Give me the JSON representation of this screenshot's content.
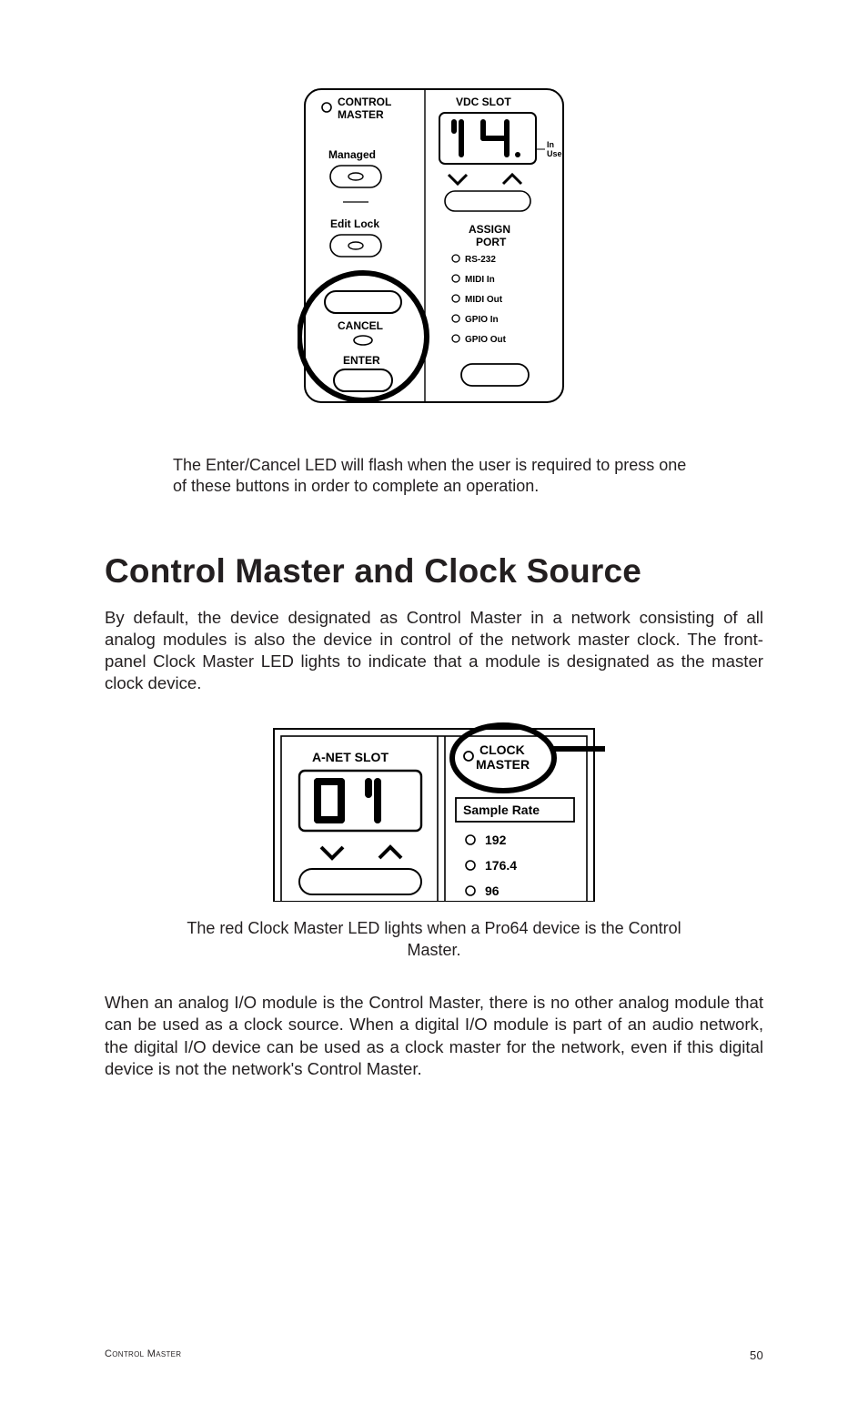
{
  "panel1": {
    "control_master": "CONTROL\nMASTER",
    "vdc_slot": "VDC SLOT",
    "in_use": "In\nUse",
    "managed": "Managed",
    "edit_lock": "Edit Lock",
    "assign_port": "ASSIGN\nPORT",
    "ports": {
      "rs232": "RS-232",
      "midi_in": "MIDI In",
      "midi_out": "MIDI Out",
      "gpio_in": "GPIO In",
      "gpio_out": "GPIO Out"
    },
    "cancel": "CANCEL",
    "enter": "ENTER"
  },
  "caption1": "The Enter/Cancel LED will flash when the user is required to press one of these buttons in order to complete an operation.",
  "section_title": "Control Master and Clock Source",
  "body1": "By default, the device designated as Control Master in a network consisting of all analog modules is also the device in control of the network master clock. The front-panel Clock Master LED lights to indicate that a module is designated as the master clock device.",
  "panel2": {
    "anet_slot": "A-NET SLOT",
    "clock_master": "CLOCK\nMASTER",
    "sample_rate": "Sample Rate",
    "rates": {
      "r192": "192",
      "r1764": "176.4",
      "r96": "96"
    }
  },
  "caption2": "The red Clock Master LED lights when a Pro64 device is the Control Master.",
  "body2": "When an analog I/O module is the Control Master, there is no other analog module that can be used as a clock source. When a digital I/O module is part of an audio network, the digital I/O device can be used as a clock master for the network, even if this digital device is not the network's Control Master.",
  "footer_left": "Control Master",
  "footer_right": "50"
}
